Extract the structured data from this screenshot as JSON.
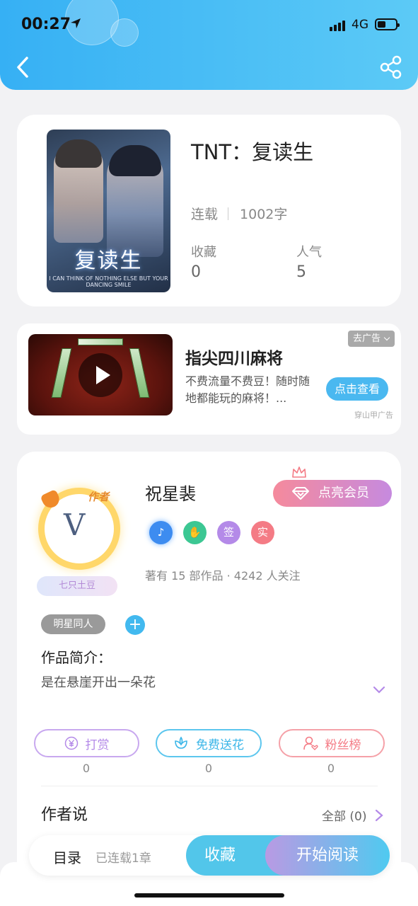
{
  "status_bar": {
    "time": "00:27",
    "network": "4G"
  },
  "header": {
    "back_icon": "chevron-left-icon",
    "share_icon": "share-icon",
    "background": "#3ab4f4"
  },
  "book": {
    "title": "TNT：复读生",
    "cover_title": "复读生",
    "cover_footer": "I CAN THINK OF NOTHING ELSE BUT YOUR DANCING SMILE",
    "status": "连载",
    "word_count": "1002字",
    "collect_label": "收藏",
    "collect_value": "0",
    "popularity_label": "人气",
    "popularity_value": "5"
  },
  "ad": {
    "title": "指尖四川麻将",
    "description": "不费流量不费豆！随时随地都能玩的麻将！...",
    "remove_label": "去广告",
    "cta_label": "点击查看",
    "source": "穿山甲广告"
  },
  "author": {
    "name": "祝星裴",
    "role_tag": "作者",
    "nickname_badge": "七只土豆",
    "vip_button": "点亮会员",
    "badges": [
      {
        "icon": "music-medal-icon",
        "label": "",
        "color": "#3d8cf0"
      },
      {
        "icon": "handshake-medal-icon",
        "label": "",
        "color": "#3cc793"
      },
      {
        "icon": "sign-badge-icon",
        "label": "签",
        "color": "#b48ae8"
      },
      {
        "icon": "verified-badge-icon",
        "label": "实",
        "color": "#f47b85"
      }
    ],
    "works_info": "著有 15 部作品 · 4242 人关注"
  },
  "tags": {
    "genre": "明星同人",
    "add_icon": "plus-icon"
  },
  "intro": {
    "label": "作品简介：",
    "text": "是在悬崖开出一朵花"
  },
  "actions": [
    {
      "label": "打赏",
      "count": "0",
      "icon": "yen-icon",
      "color": "#b48ae8"
    },
    {
      "label": "免费送花",
      "count": "0",
      "icon": "flower-icon",
      "color": "#3bb6e8"
    },
    {
      "label": "粉丝榜",
      "count": "0",
      "icon": "fan-icon",
      "color": "#f47b85"
    }
  ],
  "author_say": {
    "title": "作者说",
    "all_label": "全部 (0)"
  },
  "bottom_bar": {
    "toc_label": "目录",
    "chapters": "已连载1章",
    "collect_button": "收藏",
    "read_button": "开始阅读"
  }
}
